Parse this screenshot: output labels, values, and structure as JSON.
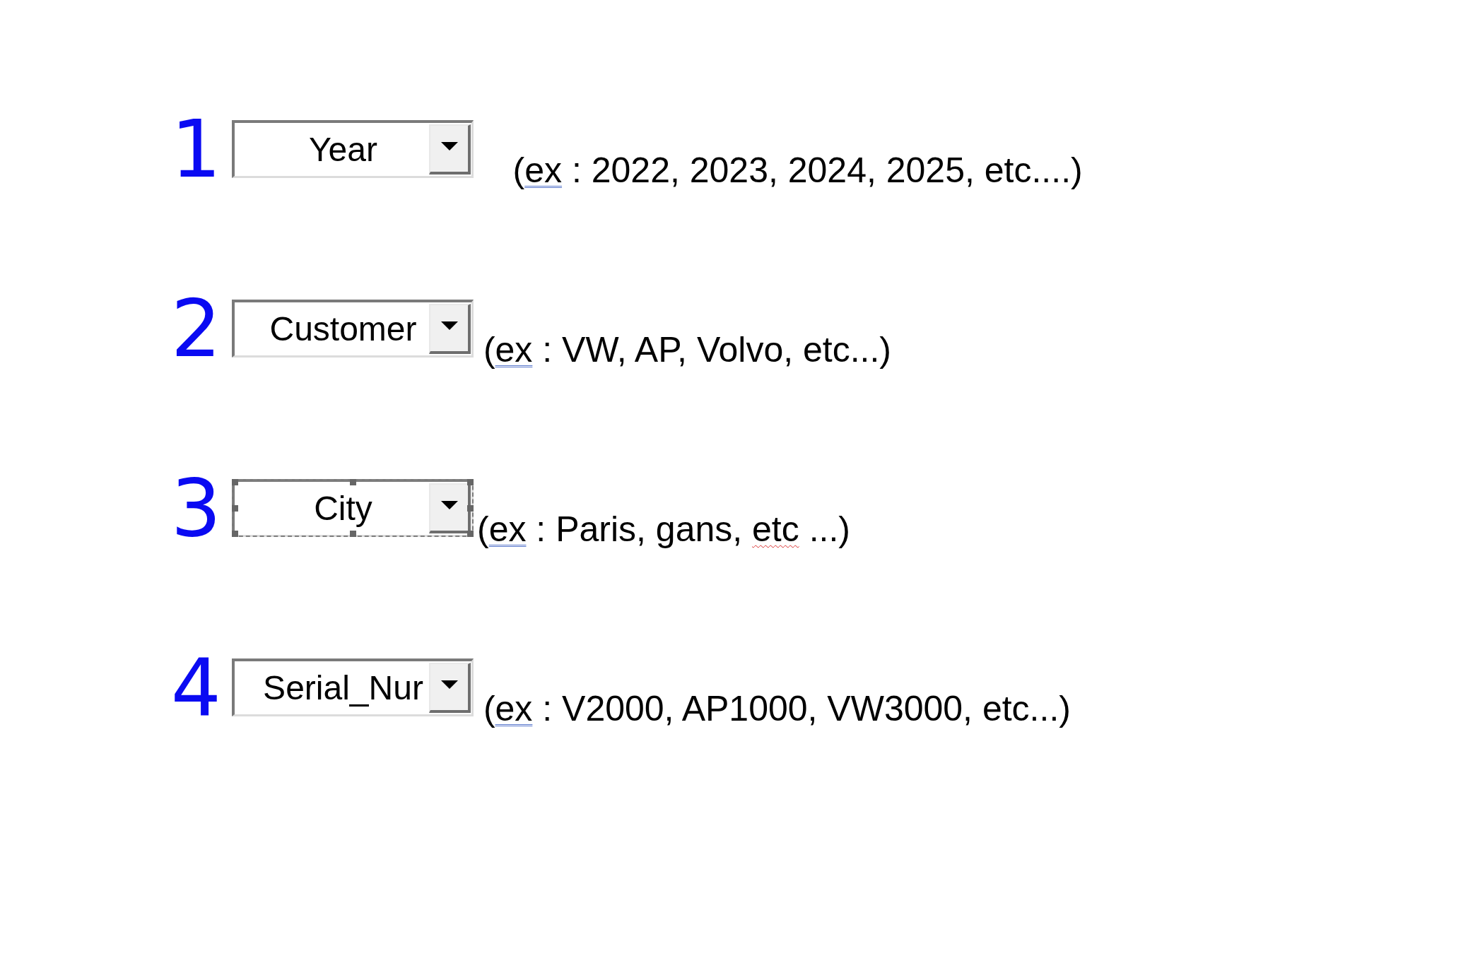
{
  "rows": [
    {
      "number": "1",
      "dropdown": {
        "value": "Year"
      },
      "selected": false,
      "example": [
        {
          "text": "    (",
          "kind": "plain"
        },
        {
          "text": "ex",
          "kind": "grammar"
        },
        {
          "text": " : 2022, 2023, 2024, 2025, etc....)",
          "kind": "plain"
        }
      ]
    },
    {
      "number": "2",
      "dropdown": {
        "value": "Customer"
      },
      "selected": false,
      "example": [
        {
          "text": " (",
          "kind": "plain"
        },
        {
          "text": "ex",
          "kind": "grammar"
        },
        {
          "text": " : VW, AP, Volvo, etc...)",
          "kind": "plain"
        }
      ]
    },
    {
      "number": "3",
      "dropdown": {
        "value": "City"
      },
      "selected": true,
      "example": [
        {
          "text": "(",
          "kind": "plain"
        },
        {
          "text": "ex",
          "kind": "grammar"
        },
        {
          "text": " : Paris, gans, ",
          "kind": "plain"
        },
        {
          "text": "etc",
          "kind": "spelling"
        },
        {
          "text": " ...)",
          "kind": "plain"
        }
      ]
    },
    {
      "number": "4",
      "dropdown": {
        "value": "Serial_Nur"
      },
      "selected": false,
      "example": [
        {
          "text": " (",
          "kind": "plain"
        },
        {
          "text": "ex",
          "kind": "grammar"
        },
        {
          "text": " : V2000, AP1000, VW3000, etc...)",
          "kind": "plain"
        }
      ]
    }
  ]
}
